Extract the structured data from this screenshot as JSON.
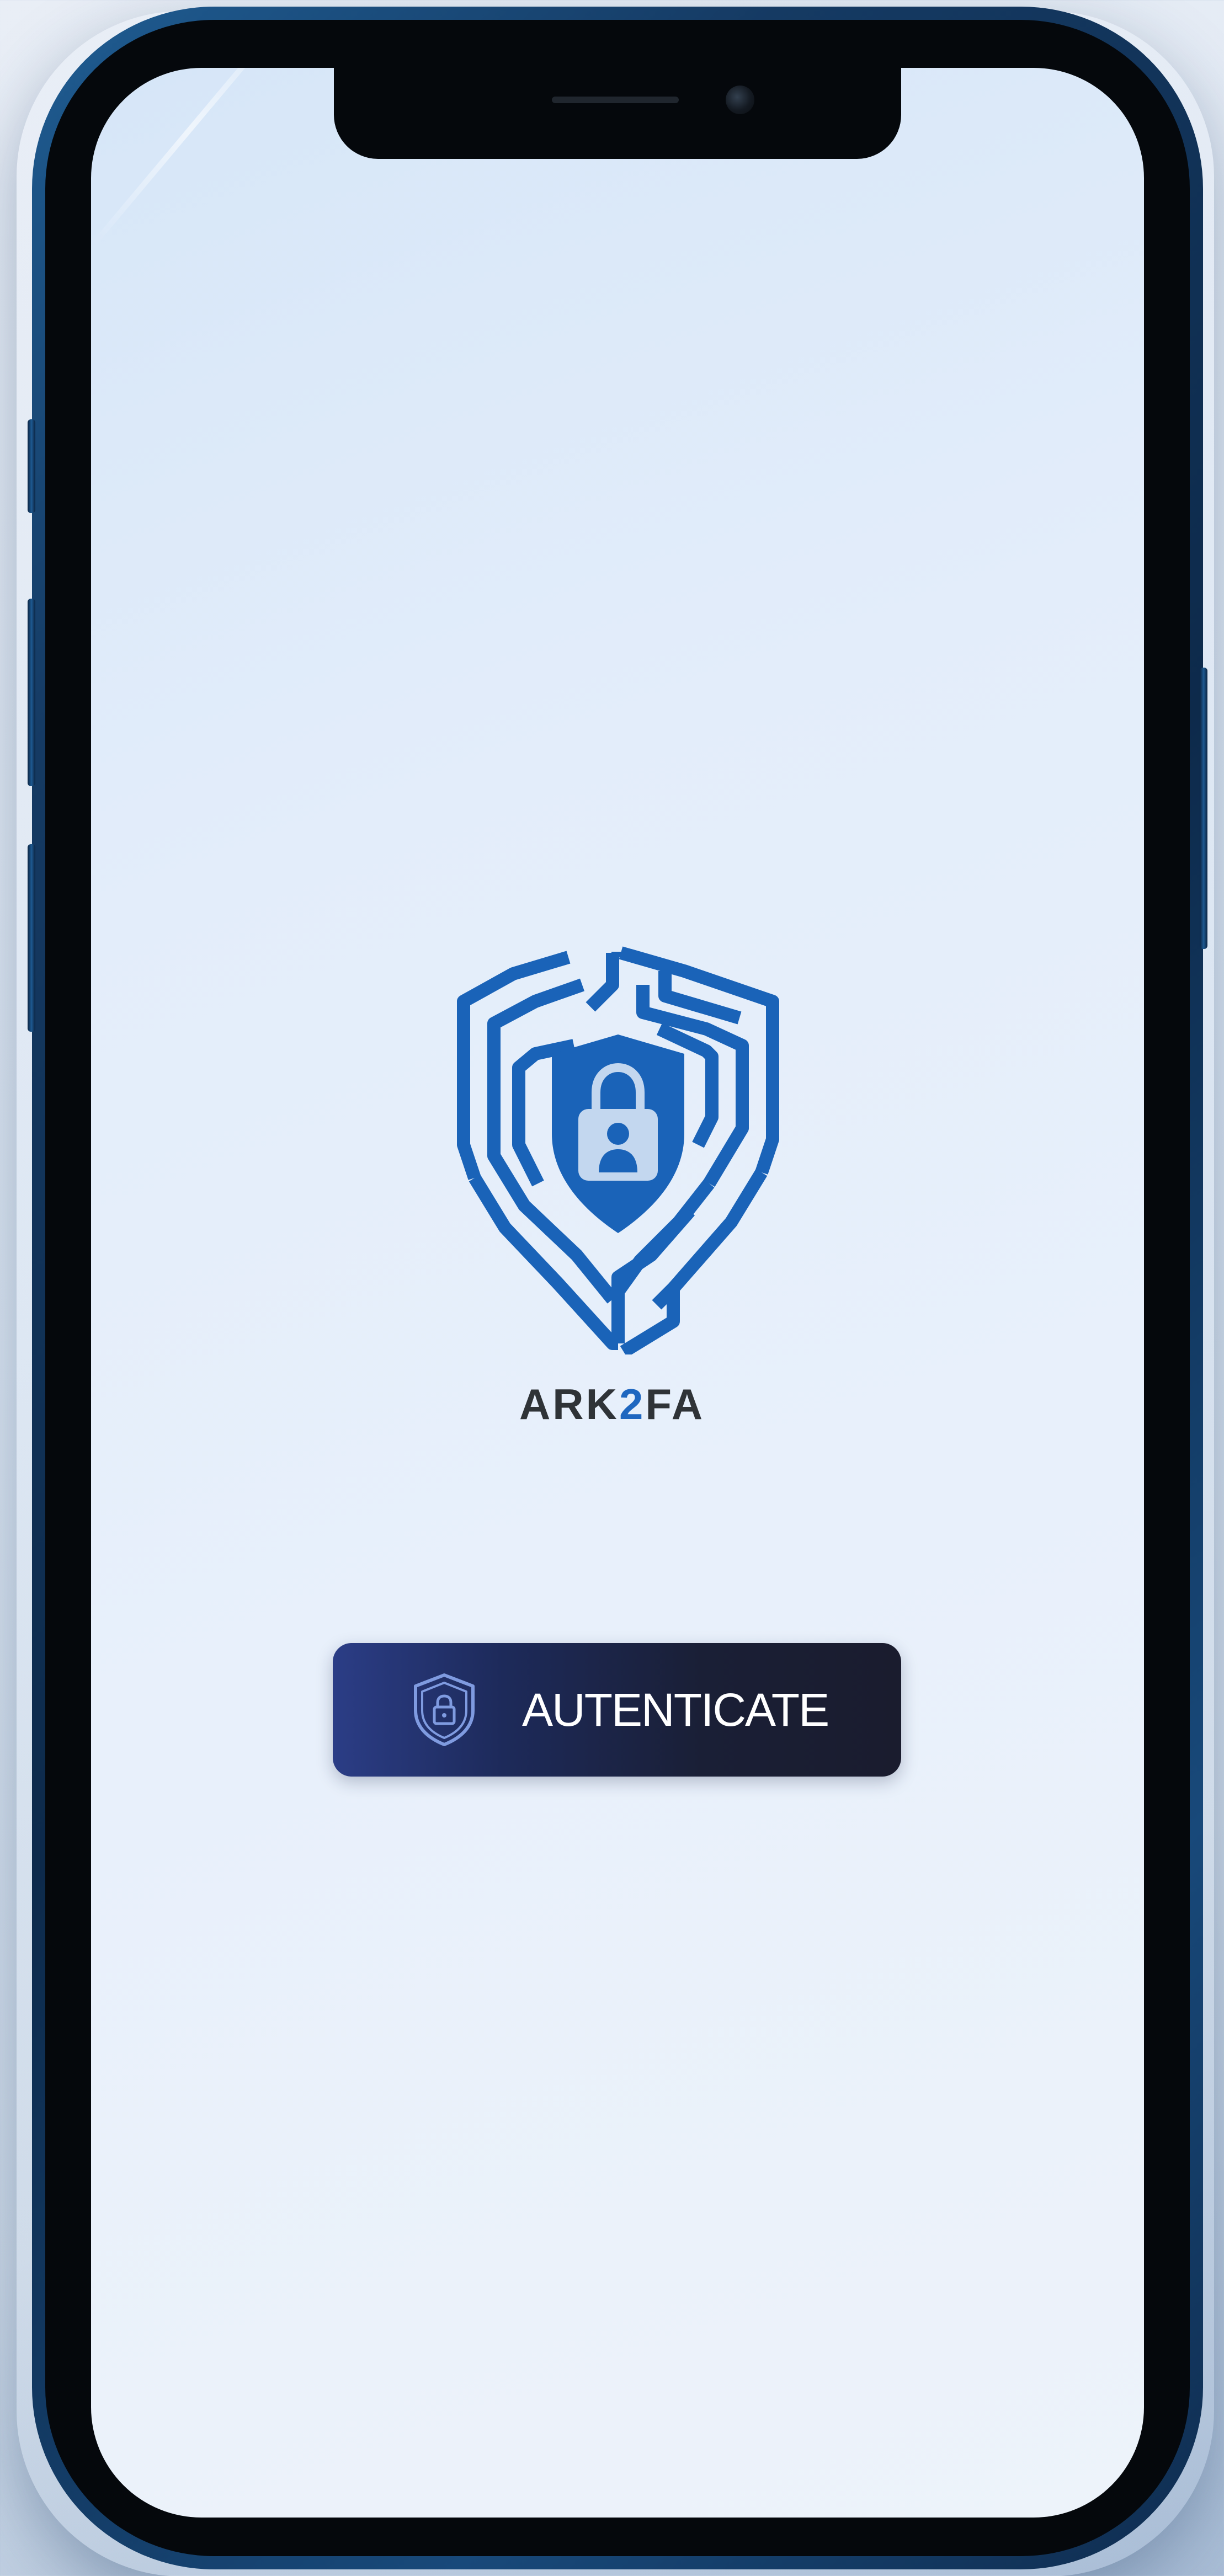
{
  "app": {
    "brand_prefix": "ARK",
    "brand_accent": "2",
    "brand_suffix": "FA",
    "brand_color": "#1f67c0",
    "logo_icon": "shield-lock-user-icon"
  },
  "auth_button": {
    "label": "AUTENTICATE",
    "icon": "shield-lock-icon",
    "background": "#1a1c2e"
  }
}
